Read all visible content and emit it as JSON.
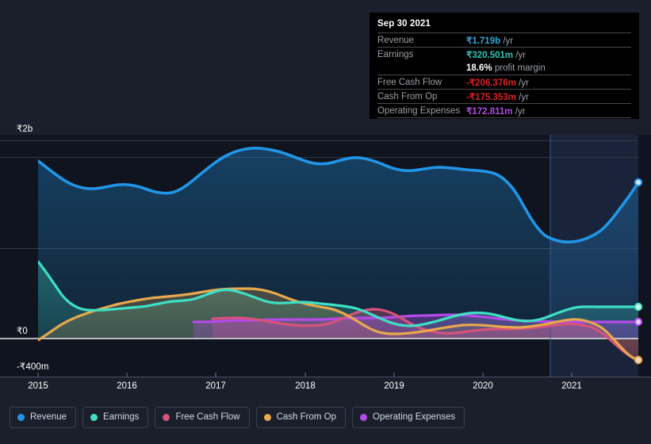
{
  "tooltip": {
    "title": "Sep 30 2021",
    "rows": [
      {
        "label": "Revenue",
        "value": "₹1.719b",
        "unit": "/yr",
        "color": "#2eaadc"
      },
      {
        "label": "Earnings",
        "value": "₹320.501m",
        "unit": "/yr",
        "color": "#2ec4b6"
      },
      {
        "label": "",
        "value": "18.6%",
        "unit": "profit margin",
        "color": "#ffffff"
      },
      {
        "label": "Free Cash Flow",
        "value": "-₹206.376m",
        "unit": "/yr",
        "color": "#e02020"
      },
      {
        "label": "Cash From Op",
        "value": "-₹175.353m",
        "unit": "/yr",
        "color": "#e02020"
      },
      {
        "label": "Operating Expenses",
        "value": "₹172.811m",
        "unit": "/yr",
        "color": "#b44ae8"
      }
    ]
  },
  "legend": {
    "items": [
      {
        "label": "Revenue",
        "color": "#2196e8"
      },
      {
        "label": "Earnings",
        "color": "#3ee0c5"
      },
      {
        "label": "Free Cash Flow",
        "color": "#d6537a"
      },
      {
        "label": "Cash From Op",
        "color": "#e8a84e"
      },
      {
        "label": "Operating Expenses",
        "color": "#b44ae8"
      }
    ]
  },
  "axes": {
    "y_labels": [
      "₹2b",
      "₹0",
      "-₹400m"
    ],
    "x_labels": [
      "2015",
      "2016",
      "2017",
      "2018",
      "2019",
      "2020",
      "2021"
    ]
  },
  "chart_data": {
    "type": "area",
    "title": "",
    "xlabel": "",
    "ylabel": "",
    "ylim": [
      -400,
      2000
    ],
    "yunit": "millions (₹)",
    "grid": true,
    "legend_position": "bottom",
    "x": [
      "2015",
      "2015.25",
      "2015.5",
      "2015.75",
      "2016",
      "2016.25",
      "2016.5",
      "2016.75",
      "2017",
      "2017.25",
      "2017.5",
      "2017.75",
      "2018",
      "2018.25",
      "2018.5",
      "2018.75",
      "2019",
      "2019.25",
      "2019.5",
      "2019.75",
      "2020",
      "2020.25",
      "2020.5",
      "2020.75",
      "2021",
      "2021.25",
      "2021.5",
      "2021.75"
    ],
    "forecast_start_x": "2020.75",
    "series": [
      {
        "name": "Revenue",
        "color": "#2196e8",
        "values": [
          1790,
          1700,
          1648,
          1650,
          1660,
          1620,
          1636,
          1650,
          1700,
          1790,
          1860,
          1880,
          1870,
          1840,
          1816,
          1840,
          1800,
          1790,
          1760,
          1742,
          1750,
          1745,
          1660,
          1310,
          1290,
          1300,
          1400,
          1570
        ]
      },
      {
        "name": "Earnings",
        "color": "#3ee0c5",
        "values": [
          590,
          430,
          290,
          262,
          260,
          258,
          262,
          268,
          290,
          300,
          288,
          330,
          360,
          350,
          300,
          290,
          295,
          290,
          268,
          200,
          150,
          135,
          165,
          210,
          250,
          150,
          210,
          320
        ]
      },
      {
        "name": "Free Cash Flow",
        "color": "#d6537a",
        "values": [
          null,
          null,
          null,
          null,
          null,
          null,
          null,
          null,
          150,
          145,
          128,
          120,
          115,
          128,
          170,
          250,
          280,
          120,
          55,
          40,
          60,
          90,
          100,
          115,
          110,
          60,
          -60,
          -206
        ]
      },
      {
        "name": "Cash From Op",
        "color": "#e8a84e",
        "values": [
          -20,
          40,
          105,
          160,
          205,
          235,
          258,
          280,
          295,
          300,
          305,
          320,
          330,
          330,
          290,
          280,
          300,
          140,
          70,
          60,
          85,
          110,
          120,
          128,
          145,
          105,
          -40,
          -175
        ]
      },
      {
        "name": "Operating Expenses",
        "color": "#b44ae8",
        "values": [
          null,
          null,
          null,
          null,
          null,
          null,
          null,
          null,
          null,
          null,
          115,
          118,
          120,
          122,
          125,
          128,
          130,
          132,
          135,
          140,
          150,
          160,
          168,
          172,
          172,
          172,
          172,
          172
        ]
      }
    ]
  }
}
